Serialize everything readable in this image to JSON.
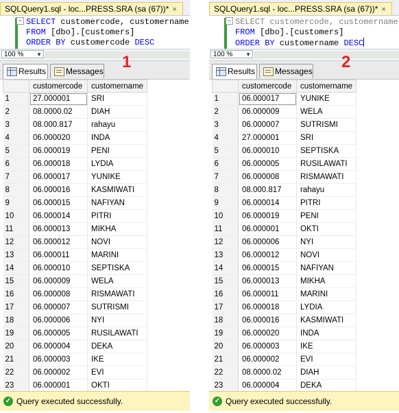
{
  "left": {
    "tab_title": "SQLQuery1.sql - loc...PRESS.SRA (sa (67))*",
    "close_glyph": "×",
    "code": {
      "line1_keyword": "SELECT",
      "line1_rest": " customercode, customername",
      "line2_keyword": "FROM",
      "line2_rest": " [dbo].[customers]",
      "line3_keyword": "ORDER BY",
      "line3_rest": " customercode ",
      "line3_tail": "DESC"
    },
    "zoom": "100 %",
    "results_tab": "Results",
    "messages_tab": "Messages",
    "label": "1",
    "columns": [
      "customercode",
      "customername"
    ],
    "rows": [
      [
        "27.000001",
        "SRI"
      ],
      [
        "08.0000.02",
        "DIAH"
      ],
      [
        "08.000.817",
        "rahayu"
      ],
      [
        "06.000020",
        "INDA"
      ],
      [
        "06.000019",
        "PENI"
      ],
      [
        "06.000018",
        "LYDIA"
      ],
      [
        "06.000017",
        "YUNIKE"
      ],
      [
        "06.000016",
        "KASMIWATI"
      ],
      [
        "06.000015",
        "NAFIYAN"
      ],
      [
        "06.000014",
        "PITRI"
      ],
      [
        "06.000013",
        "MIKHA"
      ],
      [
        "06.000012",
        "NOVI"
      ],
      [
        "06.000011",
        "MARINI"
      ],
      [
        "06.000010",
        "SEPTISKA"
      ],
      [
        "06.000009",
        "WELA"
      ],
      [
        "06.000008",
        "RISMAWATI"
      ],
      [
        "06.000007",
        "SUTRISMI"
      ],
      [
        "06.000006",
        "NYI"
      ],
      [
        "06.000005",
        "RUSILAWATI"
      ],
      [
        "06.000004",
        "DEKA"
      ],
      [
        "06.000003",
        "IKE"
      ],
      [
        "06.000002",
        "EVI"
      ],
      [
        "06.000001",
        "OKTI"
      ]
    ],
    "status": "Query executed successfully."
  },
  "right": {
    "tab_title": "SQLQuery1.sql - loc...PRESS.SRA (sa (67))*",
    "close_glyph": "×",
    "code": {
      "line1_keyword": "SELECT",
      "line1_rest": " customercode, customername",
      "line2_keyword": "FROM",
      "line2_rest": " [dbo].[customers]",
      "line3_keyword": "ORDER BY",
      "line3_rest": " customername ",
      "line3_tail": "DESC"
    },
    "zoom": "100 %",
    "results_tab": "Results",
    "messages_tab": "Messages",
    "label": "2",
    "columns": [
      "customercode",
      "customername"
    ],
    "rows": [
      [
        "06.000017",
        "YUNIKE"
      ],
      [
        "06.000009",
        "WELA"
      ],
      [
        "06.000007",
        "SUTRISMI"
      ],
      [
        "27.000001",
        "SRI"
      ],
      [
        "06.000010",
        "SEPTISKA"
      ],
      [
        "06.000005",
        "RUSILAWATI"
      ],
      [
        "06.000008",
        "RISMAWATI"
      ],
      [
        "08.000.817",
        "rahayu"
      ],
      [
        "06.000014",
        "PITRI"
      ],
      [
        "06.000019",
        "PENI"
      ],
      [
        "06.000001",
        "OKTI"
      ],
      [
        "06.000006",
        "NYI"
      ],
      [
        "06.000012",
        "NOVI"
      ],
      [
        "06.000015",
        "NAFIYAN"
      ],
      [
        "06.000013",
        "MIKHA"
      ],
      [
        "06.000011",
        "MARINI"
      ],
      [
        "06.000018",
        "LYDIA"
      ],
      [
        "06.000016",
        "KASMIWATI"
      ],
      [
        "06.000020",
        "INDA"
      ],
      [
        "06.000003",
        "IKE"
      ],
      [
        "06.000002",
        "EVI"
      ],
      [
        "08.0000.02",
        "DIAH"
      ],
      [
        "06.000004",
        "DEKA"
      ]
    ],
    "status": "Query executed successfully."
  }
}
